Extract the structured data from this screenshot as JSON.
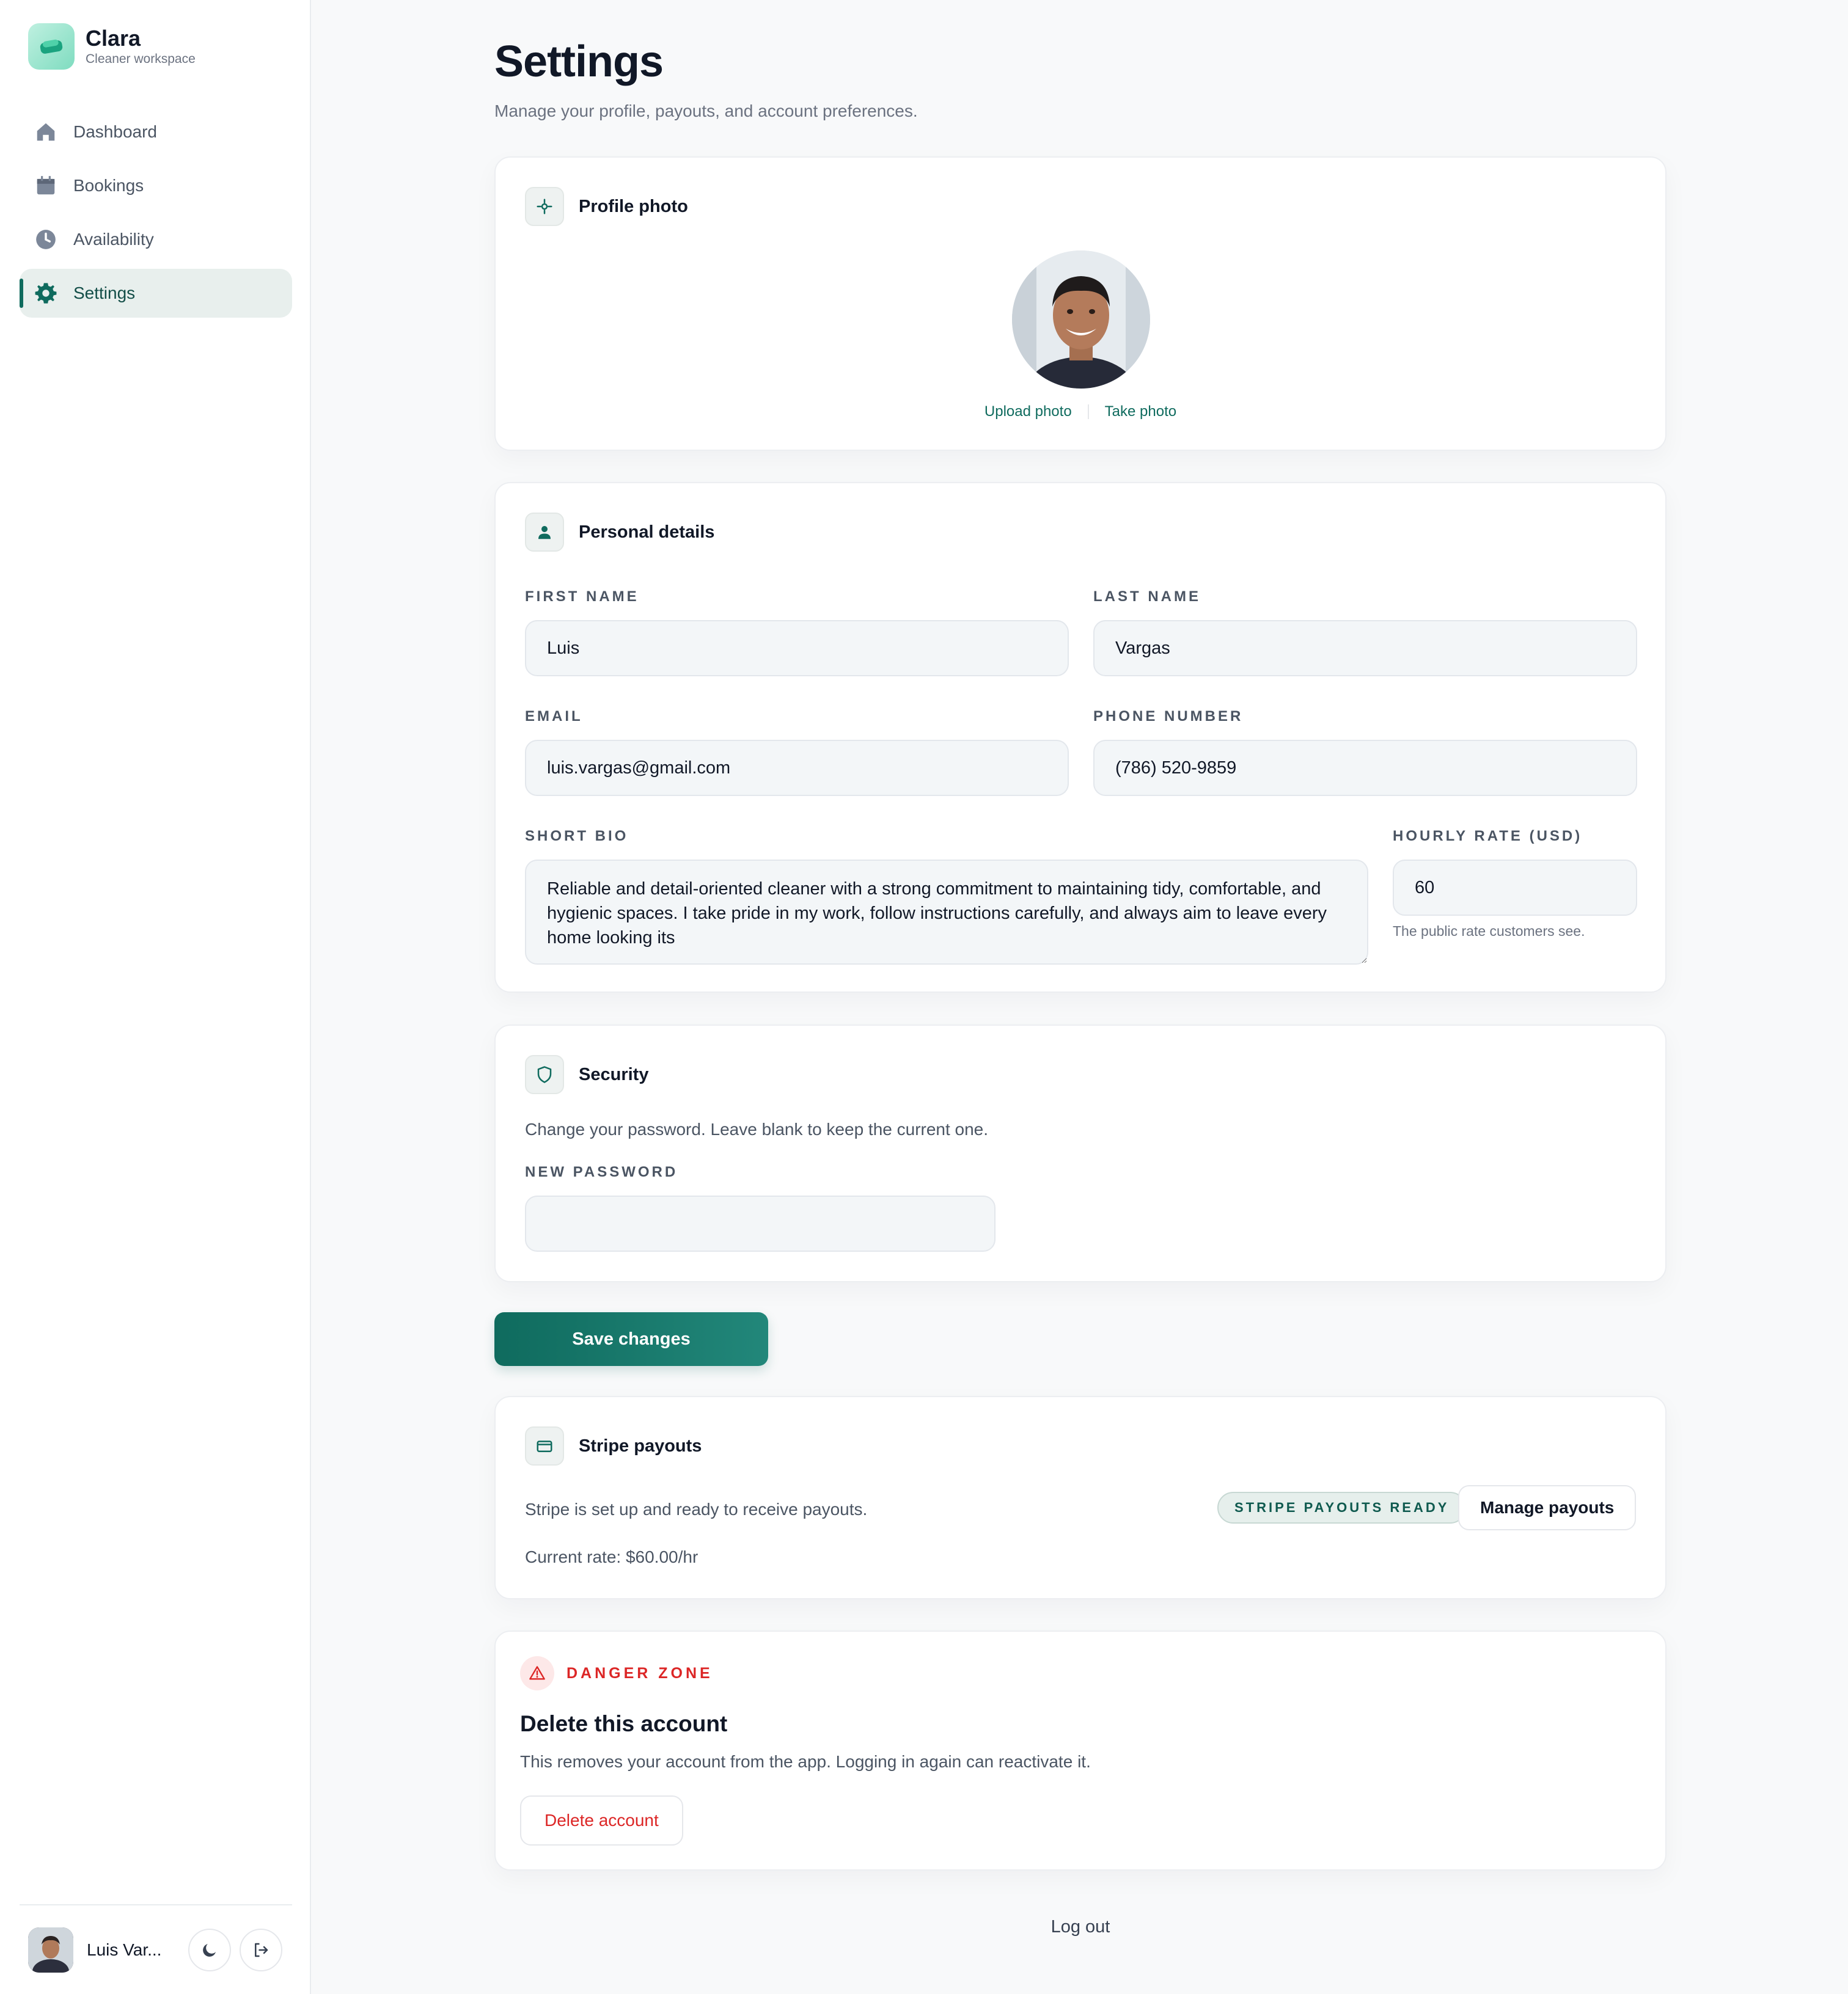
{
  "brand": {
    "name": "Clara",
    "subtitle": "Cleaner workspace"
  },
  "nav": {
    "items": [
      {
        "label": "Dashboard",
        "icon": "home-icon"
      },
      {
        "label": "Bookings",
        "icon": "calendar-icon"
      },
      {
        "label": "Availability",
        "icon": "clock-icon"
      },
      {
        "label": "Settings",
        "icon": "gear-icon",
        "active": true
      }
    ]
  },
  "user": {
    "display_name": "Luis Var..."
  },
  "page": {
    "title": "Settings",
    "subtitle": "Manage your profile, payouts, and account preferences."
  },
  "profile_photo": {
    "title": "Profile photo",
    "icon": "target-icon",
    "upload_label": "Upload photo",
    "take_label": "Take photo"
  },
  "personal": {
    "title": "Personal details",
    "icon": "person-icon",
    "first_name_label": "First name",
    "first_name": "Luis",
    "last_name_label": "Last name",
    "last_name": "Vargas",
    "email_label": "Email",
    "email": "luis.vargas@gmail.com",
    "phone_label": "Phone number",
    "phone": "(786) 520-9859",
    "bio_label": "Short bio",
    "bio": "Reliable and detail-oriented cleaner with a strong commitment to maintaining tidy, comfortable, and hygienic spaces. I take pride in my work, follow instructions carefully, and always aim to leave every home looking its",
    "rate_label": "Hourly rate (USD)",
    "rate": "60",
    "rate_hint": "The public rate customers see."
  },
  "security": {
    "title": "Security",
    "icon": "shield-icon",
    "description": "Change your password. Leave blank to keep the current one.",
    "password_label": "New password",
    "password_value": ""
  },
  "save_label": "Save changes",
  "stripe": {
    "title": "Stripe payouts",
    "icon": "credit-card-icon",
    "status": "Stripe is set up and ready to receive payouts.",
    "badge": "STRIPE PAYOUTS READY",
    "manage_label": "Manage payouts",
    "current_rate": "Current rate: $60.00/hr"
  },
  "danger": {
    "label": "DANGER ZONE",
    "icon": "warning-triangle-icon",
    "title": "Delete this account",
    "description": "This removes your account from the app. Logging in again can reactivate it.",
    "delete_label": "Delete account"
  },
  "logout_label": "Log out",
  "colors": {
    "accent": "#0f6b5e",
    "accent_light": "#e8efed",
    "danger": "#dc2626",
    "background": "#f8f9fa"
  }
}
